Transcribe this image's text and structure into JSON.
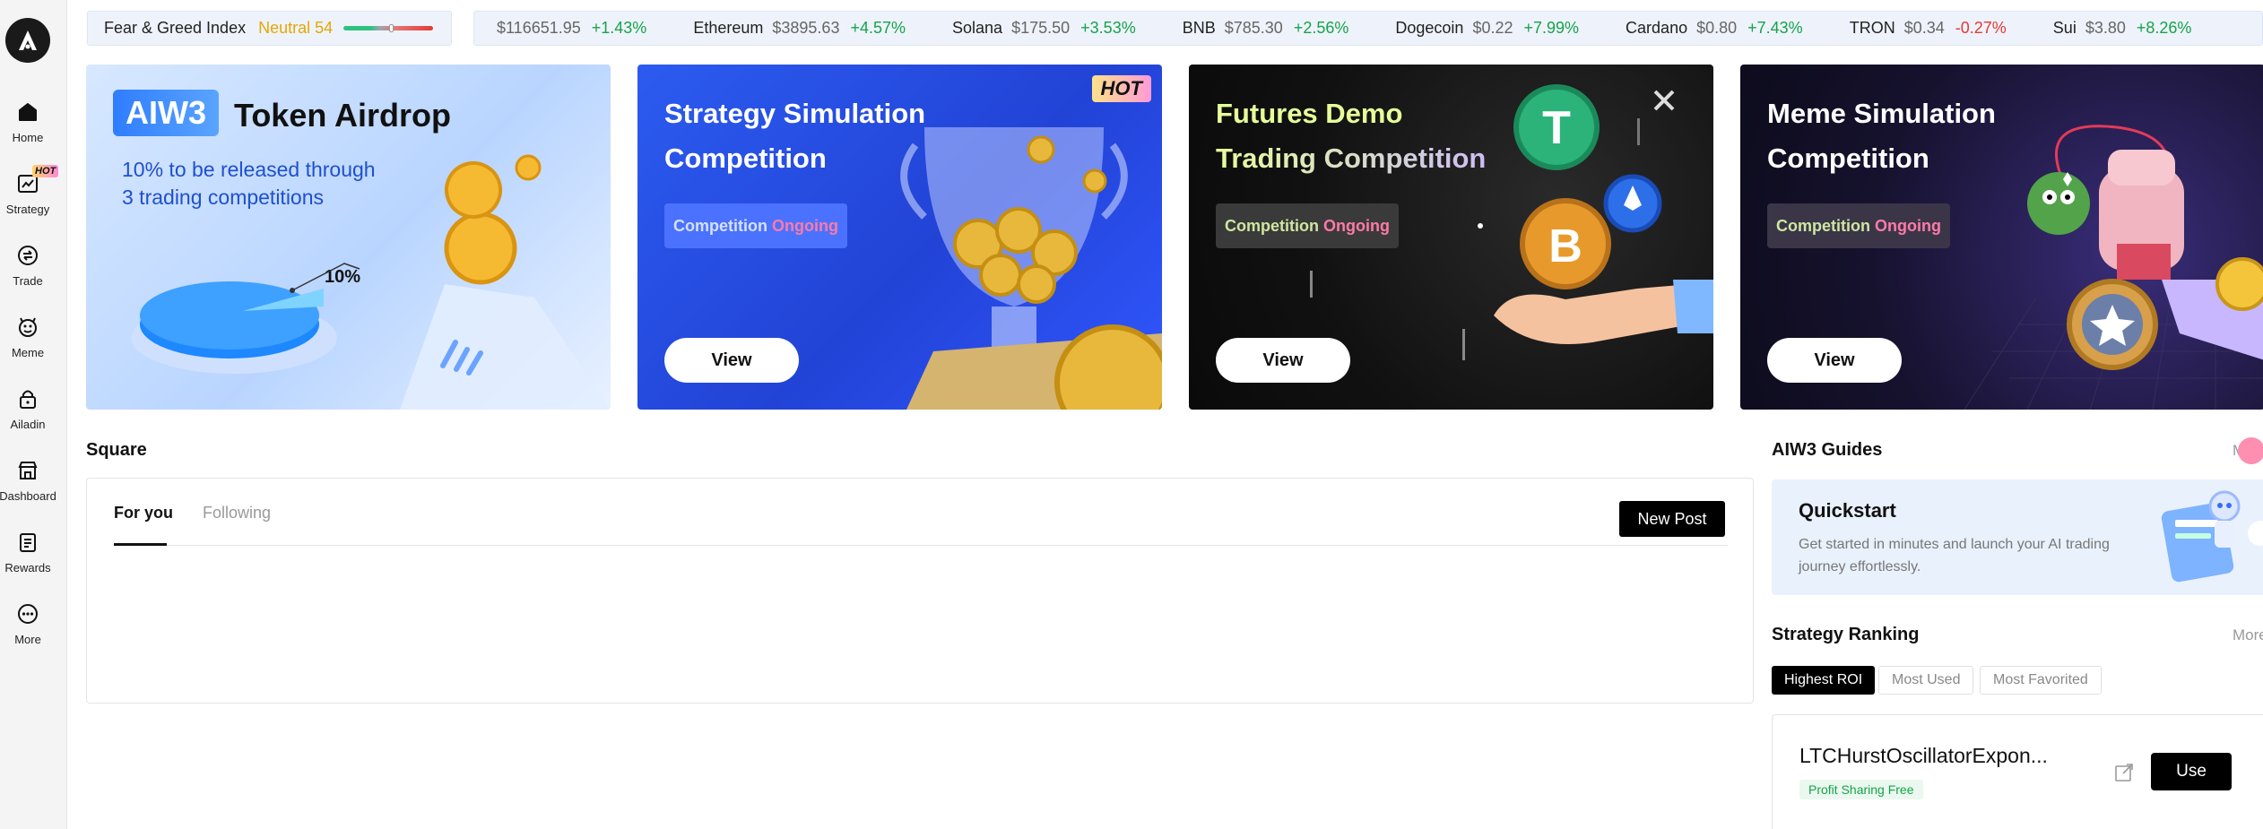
{
  "sidebar": {
    "items": [
      {
        "label": "Home",
        "icon": "home-icon"
      },
      {
        "label": "Strategy",
        "icon": "chart-icon",
        "hot": "HOT"
      },
      {
        "label": "Trade",
        "icon": "swap-icon"
      },
      {
        "label": "Meme",
        "icon": "meme-icon"
      },
      {
        "label": "Ailadin",
        "icon": "lock-icon"
      },
      {
        "label": "Dashboard",
        "icon": "store-icon"
      },
      {
        "label": "Rewards",
        "icon": "clipboard-icon"
      },
      {
        "label": "More",
        "icon": "more-icon"
      }
    ]
  },
  "fear_greed": {
    "title": "Fear & Greed Index",
    "value": "Neutral 54",
    "level": 54
  },
  "ticker": [
    {
      "name": "",
      "price": "$116651.95",
      "change": "+1.43%",
      "dir": "up"
    },
    {
      "name": "Ethereum",
      "price": "$3895.63",
      "change": "+4.57%",
      "dir": "up"
    },
    {
      "name": "Solana",
      "price": "$175.50",
      "change": "+3.53%",
      "dir": "up"
    },
    {
      "name": "BNB",
      "price": "$785.30",
      "change": "+2.56%",
      "dir": "up"
    },
    {
      "name": "Dogecoin",
      "price": "$0.22",
      "change": "+7.99%",
      "dir": "up"
    },
    {
      "name": "Cardano",
      "price": "$0.80",
      "change": "+7.43%",
      "dir": "up"
    },
    {
      "name": "TRON",
      "price": "$0.34",
      "change": "-0.27%",
      "dir": "down"
    },
    {
      "name": "Sui",
      "price": "$3.80",
      "change": "+8.26%",
      "dir": "up"
    }
  ],
  "banners": {
    "airdrop": {
      "tag": "AIW3",
      "title": "Token Airdrop",
      "line1": "10% to be released through",
      "line2": "3 trading competitions",
      "pct": "10%"
    },
    "strategy": {
      "title": "Strategy Simulation Competition",
      "badge_a": "Competition",
      "badge_b": "Ongoing",
      "hot": "HOT",
      "view": "View"
    },
    "futures": {
      "title_line1": "Futures Demo",
      "title_line2": "Trading Competition",
      "badge_a": "Competition",
      "badge_b": "Ongoing",
      "view": "View"
    },
    "meme": {
      "title": "Meme Simulation Competition",
      "badge_a": "Competition",
      "badge_b": "Ongoing",
      "view": "View"
    }
  },
  "square": {
    "title": "Square",
    "tab_for_you": "For you",
    "tab_following": "Following",
    "new_post": "New Post"
  },
  "guides": {
    "title": "AIW3 Guides",
    "more": "M",
    "quick_title": "Quickstart",
    "quick_desc": "Get started in minutes and launch your AI trading journey effortlessly."
  },
  "ranking": {
    "title": "Strategy Ranking",
    "more": "More",
    "tabs": [
      "Highest ROI",
      "Most Used",
      "Most Favorited"
    ],
    "item": {
      "name": "LTCHurstOscillatorExpon...",
      "badge": "Profit Sharing Free",
      "use": "Use"
    }
  },
  "colors": {
    "accent_green": "#16a34a",
    "accent_red": "#e53935",
    "pink": "#ff6b9a",
    "gold": "#e6a700"
  }
}
